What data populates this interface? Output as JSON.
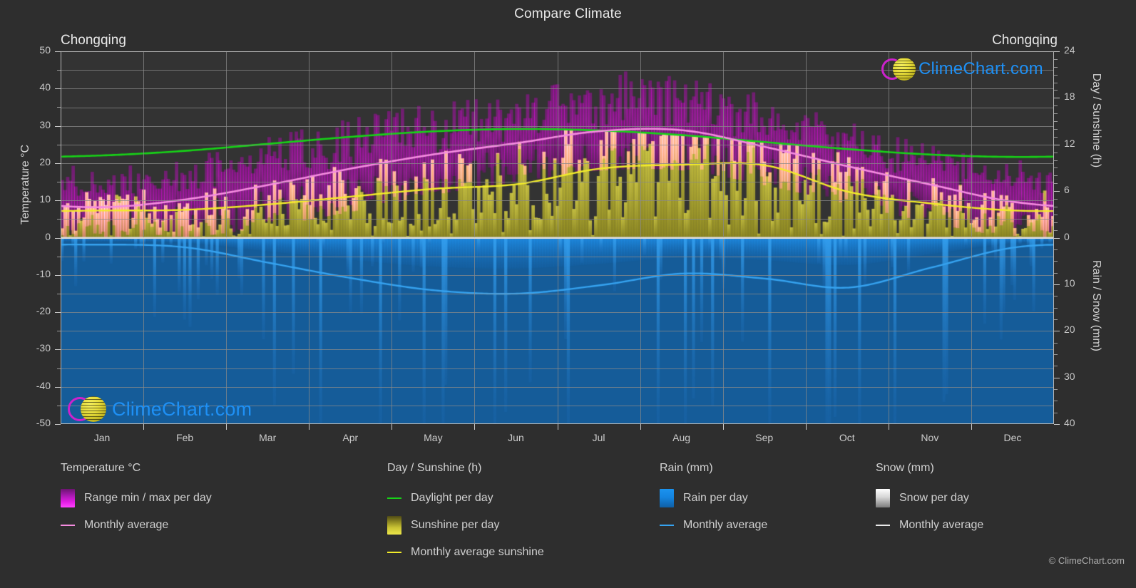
{
  "header": {
    "title": "Compare Climate",
    "city_left": "Chongqing",
    "city_right": "Chongqing"
  },
  "axes": {
    "left_title": "Temperature °C",
    "right_top_title": "Day / Sunshine (h)",
    "right_bottom_title": "Rain / Snow (mm)",
    "left_ticks": [
      "50",
      "40",
      "30",
      "20",
      "10",
      "0",
      "-10",
      "-20",
      "-30",
      "-40",
      "-50"
    ],
    "right_top_ticks": [
      "24",
      "18",
      "12",
      "6",
      "0"
    ],
    "right_bottom_ticks": [
      "0",
      "10",
      "20",
      "30",
      "40"
    ],
    "x_ticks": [
      "Jan",
      "Feb",
      "Mar",
      "Apr",
      "May",
      "Jun",
      "Jul",
      "Aug",
      "Sep",
      "Oct",
      "Nov",
      "Dec"
    ]
  },
  "legend": {
    "temperature": {
      "title": "Temperature °C",
      "range_label": "Range min / max per day",
      "avg_label": "Monthly average",
      "range_color": "#e31ce3",
      "avg_color": "#f58ce0"
    },
    "sunshine": {
      "title": "Day / Sunshine (h)",
      "daylight_label": "Daylight per day",
      "sunshine_label": "Sunshine per day",
      "avg_label": "Monthly average sunshine",
      "daylight_color": "#17d317",
      "sunshine_color": "#e9e33c",
      "avg_color": "#f2ec2a"
    },
    "rain": {
      "title": "Rain (mm)",
      "rain_label": "Rain per day",
      "avg_label": "Monthly average",
      "rain_color": "#1385e0",
      "avg_color": "#36a3f0"
    },
    "snow": {
      "title": "Snow (mm)",
      "snow_label": "Snow per day",
      "avg_label": "Monthly average",
      "snow_color": "#e8e8e8",
      "avg_color": "#e8e8e8"
    },
    "copyright": "© ClimeChart.com"
  },
  "watermark": {
    "text": "ClimeChart.com"
  },
  "chart_data": {
    "type": "area",
    "title": "Compare Climate",
    "subtitle": "Chongqing",
    "location": "Chongqing",
    "xlabel": "",
    "ylabel": "Temperature °C",
    "ylabel_right_top": "Day / Sunshine (h)",
    "ylabel_right_bottom": "Rain / Snow (mm)",
    "ylim": [
      -50,
      50
    ],
    "ylim_right_top": [
      0,
      24
    ],
    "ylim_right_bottom": [
      0,
      40
    ],
    "grid": true,
    "legend_position": "below",
    "categories": [
      "Jan",
      "Feb",
      "Mar",
      "Apr",
      "May",
      "Jun",
      "Jul",
      "Aug",
      "Sep",
      "Oct",
      "Nov",
      "Dec"
    ],
    "series": [
      {
        "name": "Monthly average temperature",
        "unit": "°C",
        "axis": "left",
        "color": "#f58ce0",
        "values": [
          8.2,
          10.3,
          14.2,
          18.6,
          22.4,
          25.4,
          28.6,
          28.8,
          24.3,
          19.1,
          14.2,
          9.6
        ]
      },
      {
        "name": "Range max per day",
        "unit": "°C",
        "axis": "left",
        "color": "#e31ce3",
        "values": [
          16.0,
          18.5,
          24.0,
          29.0,
          33.0,
          35.5,
          41.0,
          41.0,
          35.0,
          28.0,
          23.0,
          18.0
        ]
      },
      {
        "name": "Range min per day",
        "unit": "°C",
        "axis": "left",
        "color": "#e31ce3",
        "values": [
          2.0,
          3.0,
          6.0,
          10.0,
          14.5,
          18.0,
          21.0,
          21.0,
          17.0,
          12.0,
          7.0,
          3.0
        ]
      },
      {
        "name": "Daylight per day",
        "unit": "h",
        "axis": "right_top",
        "color": "#17d317",
        "values": [
          10.6,
          11.2,
          12.1,
          13.0,
          13.7,
          14.0,
          13.8,
          13.2,
          12.3,
          11.4,
          10.7,
          10.4
        ]
      },
      {
        "name": "Monthly average sunshine",
        "unit": "h",
        "axis": "right_top",
        "color": "#f2ec2a",
        "values": [
          3.5,
          3.6,
          4.3,
          5.3,
          6.3,
          6.9,
          8.9,
          9.4,
          9.3,
          5.9,
          4.4,
          3.5
        ]
      },
      {
        "name": "Monthly average rain",
        "unit": "mm",
        "axis": "right_bottom",
        "color": "#36a3f0",
        "values": [
          1.5,
          2.1,
          5.4,
          8.7,
          11.3,
          12.0,
          10.2,
          7.7,
          8.8,
          10.7,
          6.4,
          2.1
        ]
      },
      {
        "name": "Monthly average snow",
        "unit": "mm",
        "axis": "right_bottom",
        "color": "#e8e8e8",
        "values": [
          0,
          0,
          0,
          0,
          0,
          0,
          0,
          0,
          0,
          0,
          0,
          0
        ]
      }
    ]
  }
}
